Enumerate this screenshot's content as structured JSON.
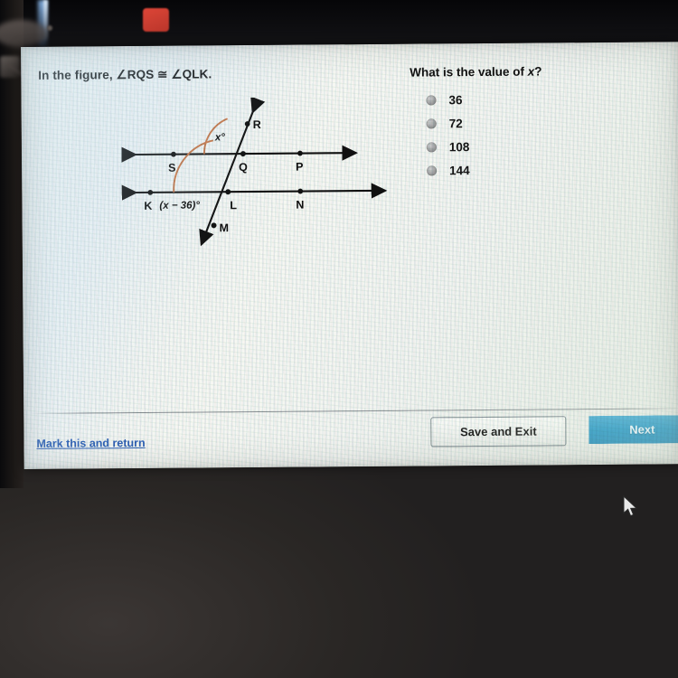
{
  "window": {
    "device_chrome": {
      "red_indicator_color": "#e8493a",
      "screen_bg_color": "#f2f4f0"
    }
  },
  "question_panel": {
    "prompt_prefix": "In the figure, ",
    "prompt_angle_1": "∠RQS",
    "prompt_relation": "≅",
    "prompt_angle_2": "∠QLK",
    "prompt_suffix": ".",
    "question_prefix": "What is the value of ",
    "question_variable": "x",
    "question_suffix": "?",
    "choices": [
      {
        "label": "36",
        "selected": false
      },
      {
        "label": "72",
        "selected": false
      },
      {
        "label": "108",
        "selected": false
      },
      {
        "label": "144",
        "selected": false
      }
    ]
  },
  "figure": {
    "type": "geometry-diagram",
    "description": "Two parallel horizontal lines cut by a transversal",
    "accent_color": "#c8784a",
    "line_color": "#101010",
    "point_labels": {
      "R": "R",
      "S": "S",
      "Q": "Q",
      "P": "P",
      "K": "K",
      "L": "L",
      "N": "N",
      "M": "M"
    },
    "angle_labels": {
      "at_Q": "x°",
      "at_L": "(x − 36)°"
    }
  },
  "footer": {
    "mark_link": "Mark this and return",
    "save_button": "Save and Exit",
    "next_button": "Next",
    "next_button_color": "#2e9cc9",
    "link_color": "#2f63b8"
  }
}
